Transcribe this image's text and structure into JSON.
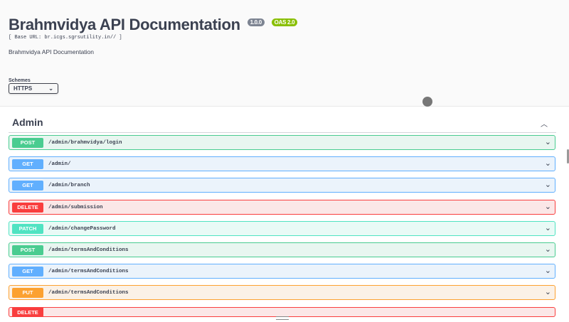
{
  "info": {
    "title": "Brahmvidya API Documentation",
    "version_badge": "1.0.0",
    "oas_badge": "OAS 2.0",
    "base_url": "[ Base URL: br.icgs.sgrsutility.in// ]",
    "description": "Brahmvidya API Documentation"
  },
  "schemes": {
    "label": "Schemes",
    "selected": "HTTPS"
  },
  "tag": {
    "name": "Admin"
  },
  "operations": [
    {
      "method": "POST",
      "path": "/admin/brahmvidya/login"
    },
    {
      "method": "GET",
      "path": "/admin/"
    },
    {
      "method": "GET",
      "path": "/admin/branch"
    },
    {
      "method": "DELETE",
      "path": "/admin/submission"
    },
    {
      "method": "PATCH",
      "path": "/admin/changePassword"
    },
    {
      "method": "POST",
      "path": "/admin/termsAndConditions"
    },
    {
      "method": "GET",
      "path": "/admin/termsAndConditions"
    },
    {
      "method": "PUT",
      "path": "/admin/termsAndConditions"
    },
    {
      "method": "DELETE",
      "path": ""
    }
  ],
  "colors": {
    "post": "#49cc90",
    "get": "#61affe",
    "delete": "#f93e3e",
    "patch": "#50e3c2",
    "put": "#fca130"
  }
}
